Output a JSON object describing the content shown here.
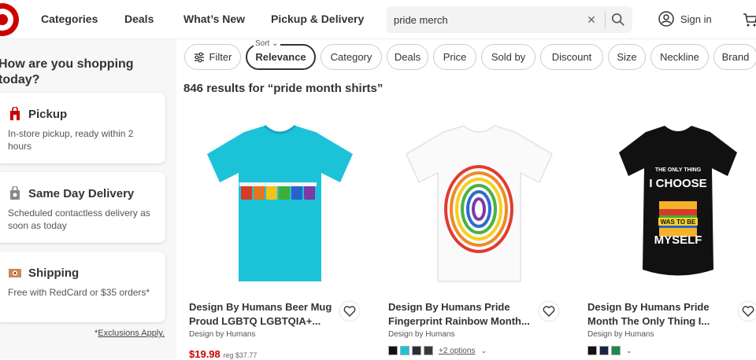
{
  "header": {
    "nav": [
      "Categories",
      "Deals",
      "What’s New",
      "Pickup & Delivery"
    ],
    "search_value": "pride merch",
    "signin": "Sign in"
  },
  "sidebar": {
    "heading": "How are you shopping today?",
    "options": [
      {
        "title": "Pickup",
        "desc": "In-store pickup, ready within 2 hours",
        "icon": "store-icon"
      },
      {
        "title": "Same Day Delivery",
        "desc": "Scheduled contactless delivery as soon as today",
        "icon": "delivery-bag-icon"
      },
      {
        "title": "Shipping",
        "desc": "Free with RedCard or $35 orders*",
        "icon": "shipping-box-icon"
      }
    ],
    "exclusions_prefix": "*",
    "exclusions_link": "Exclusions Apply."
  },
  "filters": {
    "filter_label": "Filter",
    "sort_caption": "Sort",
    "sort_value": "Relevance",
    "chips": [
      "Category",
      "Deals",
      "Price",
      "Sold by",
      "Discount",
      "Size",
      "Neckline",
      "Brand"
    ]
  },
  "results_text": "846 results for “pride month shirts”",
  "products": [
    {
      "title": "Design By Humans Beer Mug Proud LGBTQ LGBTQIA+...",
      "brand": "Design by Humans",
      "price": "$19.98",
      "reg": "reg $37.77",
      "shirt_color": "#1cc3d8"
    },
    {
      "title": "Design By Humans Pride Fingerprint Rainbow Month...",
      "brand": "Design by Humans",
      "more_options": "+2 options",
      "swatches": [
        "#111111",
        "#1cc3d8",
        "#2a2f3a",
        "#3a3a3a"
      ],
      "shirt_color": "#ffffff"
    },
    {
      "title": "Design By Humans Pride Month The Only Thing I...",
      "brand": "Design by Humans",
      "swatches": [
        "#111111",
        "#1a2340",
        "#1b8a4a"
      ],
      "shirt_color": "#111111",
      "graphic_lines": [
        "THE ONLY THING",
        "I CHOOSE",
        "WAS TO BE",
        "MYSELF"
      ]
    }
  ],
  "colors": {
    "brand_red": "#cc0000"
  }
}
